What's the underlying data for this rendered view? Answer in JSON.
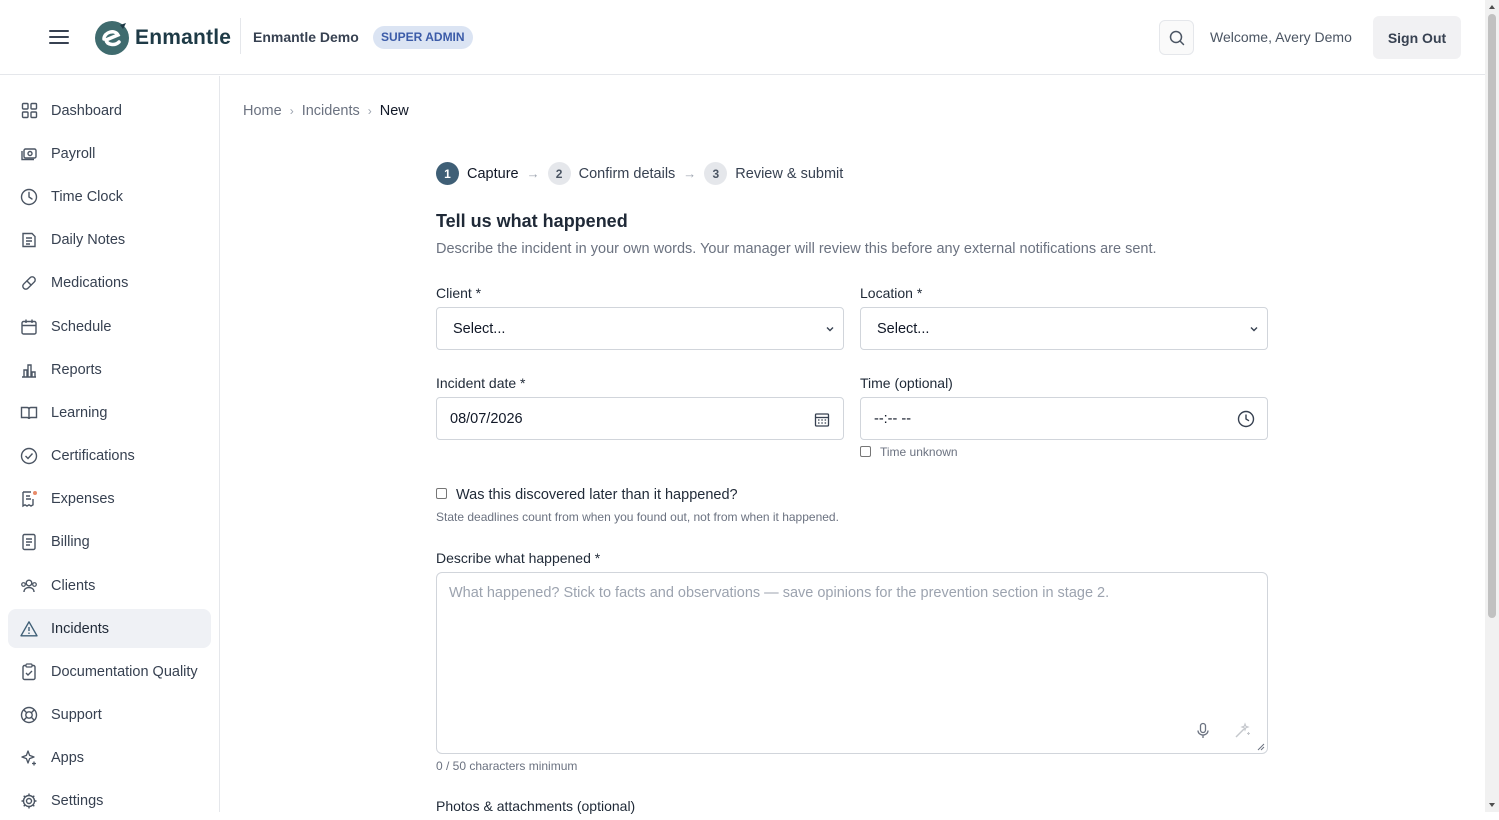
{
  "header": {
    "logo_text": "Enmantle",
    "org_name": "Enmantle Demo",
    "role_badge": "SUPER ADMIN",
    "welcome": "Welcome, Avery Demo",
    "sign_out": "Sign Out"
  },
  "sidebar": {
    "items": [
      {
        "label": "Dashboard",
        "icon": "grid-icon"
      },
      {
        "label": "Payroll",
        "icon": "payroll-icon"
      },
      {
        "label": "Time Clock",
        "icon": "clock-icon"
      },
      {
        "label": "Daily Notes",
        "icon": "notes-icon"
      },
      {
        "label": "Medications",
        "icon": "pill-icon"
      },
      {
        "label": "Schedule",
        "icon": "calendar-icon"
      },
      {
        "label": "Reports",
        "icon": "bar-chart-icon"
      },
      {
        "label": "Learning",
        "icon": "book-icon"
      },
      {
        "label": "Certifications",
        "icon": "check-circle-icon"
      },
      {
        "label": "Expenses",
        "icon": "receipt-icon"
      },
      {
        "label": "Billing",
        "icon": "document-icon"
      },
      {
        "label": "Clients",
        "icon": "users-icon"
      },
      {
        "label": "Incidents",
        "icon": "warning-icon",
        "active": true
      },
      {
        "label": "Documentation Quality",
        "icon": "clipboard-check-icon"
      },
      {
        "label": "Support",
        "icon": "lifebuoy-icon"
      },
      {
        "label": "Apps",
        "icon": "sparkle-icon"
      },
      {
        "label": "Settings",
        "icon": "gear-icon"
      }
    ]
  },
  "breadcrumb": {
    "items": [
      "Home",
      "Incidents",
      "New"
    ]
  },
  "stepper": {
    "steps": [
      {
        "num": "1",
        "label": "Capture"
      },
      {
        "num": "2",
        "label": "Confirm details"
      },
      {
        "num": "3",
        "label": "Review & submit"
      }
    ]
  },
  "form": {
    "title": "Tell us what happened",
    "subtitle": "Describe the incident in your own words. Your manager will review this before any external notifications are sent.",
    "client_label": "Client *",
    "client_value": "Select...",
    "location_label": "Location *",
    "location_value": "Select...",
    "date_label": "Incident date *",
    "date_value": "08/07/2026",
    "time_label": "Time (optional)",
    "time_value": "--:-- --",
    "time_unknown": "Time unknown",
    "discovered_label": "Was this discovered later than it happened?",
    "discovered_hint": "State deadlines count from when you found out, not from when it happened.",
    "describe_label": "Describe what happened *",
    "describe_placeholder": "What happened? Stick to facts and observations — save opinions for the prevention section in stage 2.",
    "counter": "0 / 50 characters minimum",
    "photos_label": "Photos & attachments (optional)"
  }
}
